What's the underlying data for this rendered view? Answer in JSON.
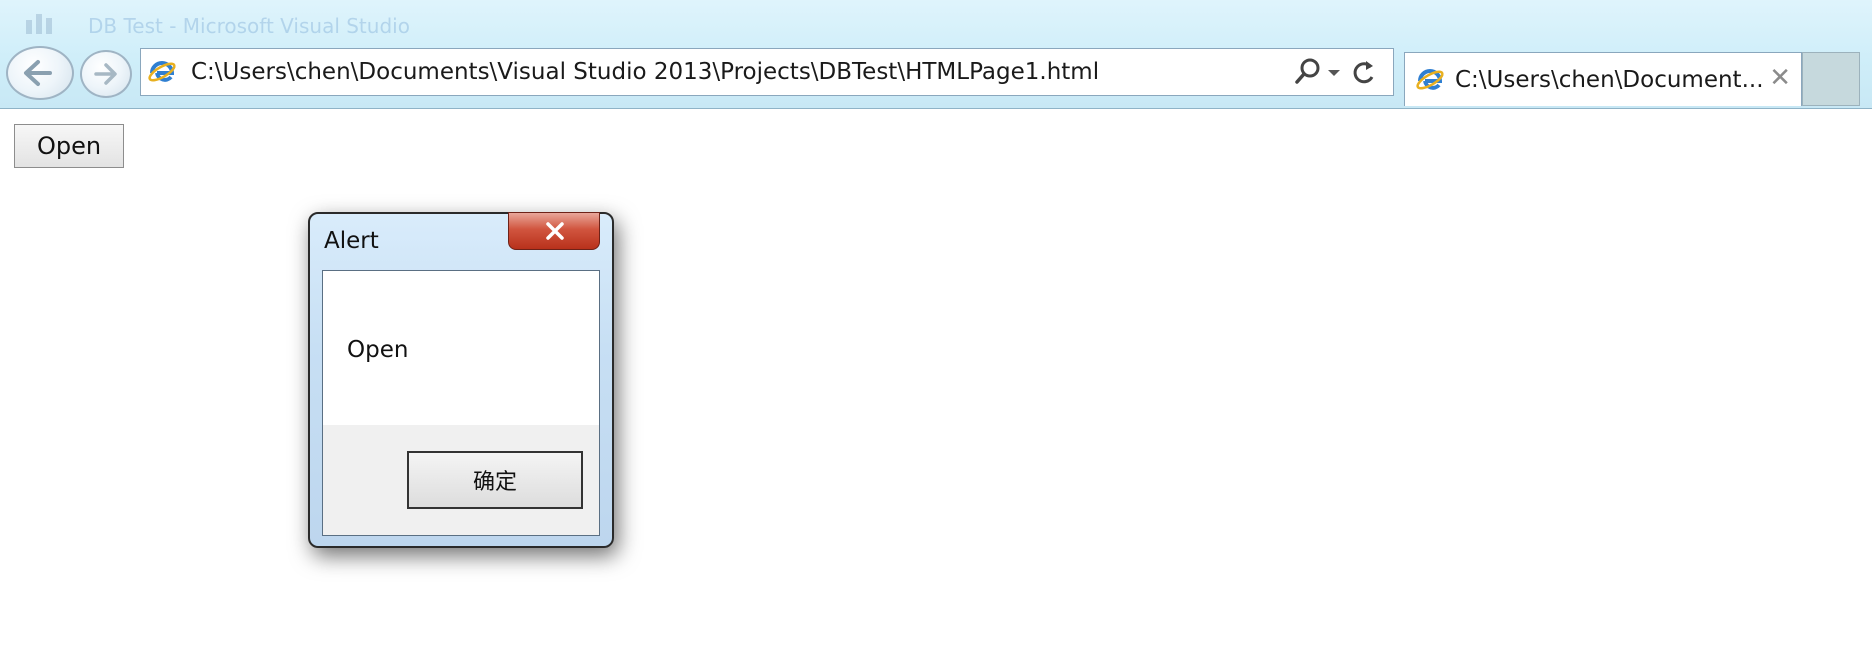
{
  "window": {
    "title": "DB Test - Microsoft Visual Studio"
  },
  "address_bar": {
    "url": "C:\\Users\\chen\\Documents\\Visual Studio 2013\\Projects\\DBTest\\HTMLPage1.html",
    "icons": [
      "ie-page-icon",
      "search-icon",
      "dropdown-arrow-icon",
      "refresh-icon"
    ]
  },
  "tab": {
    "label": "C:\\Users\\chen\\Document...",
    "close_glyph": "✕"
  },
  "page": {
    "open_button_label": "Open"
  },
  "dialog": {
    "title": "Alert",
    "message": "Open",
    "ok_label": "确定",
    "close_glyph": "x"
  },
  "colors": {
    "chrome_bg": "#d3effa",
    "dialog_frame": "#c7dff4",
    "close_button": "#d1553f",
    "footer_bg": "#f0f0f0"
  }
}
